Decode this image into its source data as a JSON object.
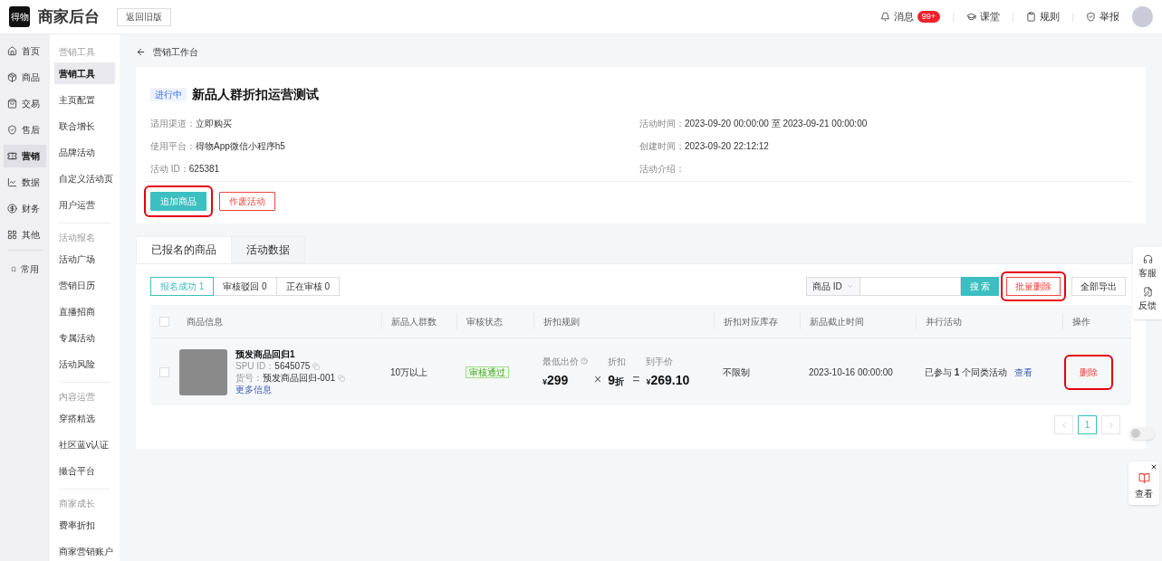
{
  "header": {
    "logo": "得物",
    "title": "商家后台",
    "old_version_button": "返回旧版",
    "links": [
      {
        "kind": "bell",
        "label": "消息",
        "badge": "99+"
      },
      {
        "kind": "cap",
        "label": "课堂"
      },
      {
        "kind": "clipboard",
        "label": "规则"
      },
      {
        "kind": "shield",
        "label": "举报"
      }
    ]
  },
  "main_nav": {
    "groups": [
      [
        {
          "kind": "home",
          "label": "首页",
          "selected": false
        },
        {
          "kind": "box",
          "label": "商品",
          "selected": false
        },
        {
          "kind": "bag",
          "label": "交易",
          "selected": false
        },
        {
          "kind": "shield",
          "label": "售后",
          "selected": false
        },
        {
          "kind": "ticket",
          "label": "营销",
          "selected": true
        },
        {
          "kind": "chart",
          "label": "数据",
          "selected": false
        },
        {
          "kind": "coin",
          "label": "财务",
          "selected": false
        },
        {
          "kind": "grid",
          "label": "其他",
          "selected": false
        }
      ],
      [
        {
          "kind": "bookmark",
          "label": "常用",
          "selected": false
        }
      ]
    ]
  },
  "sub_nav": [
    {
      "heading": "营销工具",
      "items": [
        {
          "label": "营销工具",
          "selected": true
        },
        {
          "label": "主页配置",
          "selected": false
        },
        {
          "label": "联合增长",
          "selected": false
        },
        {
          "label": "品牌活动",
          "selected": false
        },
        {
          "label": "自定义活动页",
          "selected": false
        },
        {
          "label": "用户运营",
          "selected": false
        }
      ]
    },
    {
      "heading": "活动报名",
      "items": [
        {
          "label": "活动广场",
          "selected": false
        },
        {
          "label": "营销日历",
          "selected": false
        },
        {
          "label": "直播招商",
          "selected": false
        },
        {
          "label": "专属活动",
          "selected": false
        },
        {
          "label": "活动风险",
          "selected": false
        }
      ]
    },
    {
      "heading": "内容运营",
      "items": [
        {
          "label": "穿搭精选",
          "selected": false
        },
        {
          "label": "社区蓝v认证",
          "selected": false
        },
        {
          "label": "撮合平台",
          "selected": false
        }
      ]
    },
    {
      "heading": "商家成长",
      "items": [
        {
          "label": "费率折扣",
          "selected": false
        },
        {
          "label": "商家营销账户",
          "selected": false
        }
      ]
    }
  ],
  "breadcrumb": "营销工作台",
  "activity": {
    "status": "进行中",
    "title": "新品人群折扣运营测试",
    "fields_left": [
      {
        "label": "适用渠道：",
        "value": "立即购买"
      },
      {
        "label": "使用平台：",
        "value": "得物App微信小程序h5"
      },
      {
        "label": "活动 ID：",
        "value": "625381"
      }
    ],
    "fields_right": [
      {
        "label": "活动时间：",
        "value": "2023-09-20 00:00:00 至 2023-09-21 00:00:00"
      },
      {
        "label": "创建时间：",
        "value": "2023-09-20 22:12:12"
      },
      {
        "label": "活动介绍："
      }
    ],
    "buttons": [
      {
        "kind": "primary",
        "label": "追加商品",
        "highlighted": true
      },
      {
        "kind": "danger",
        "label": "作废活动",
        "highlighted": false
      }
    ]
  },
  "tabs": [
    {
      "label": "已报名的商品",
      "selected": true
    },
    {
      "label": "活动数据",
      "selected": false
    }
  ],
  "filters": [
    {
      "label": "报名成功 1",
      "selected": true
    },
    {
      "label": "审核驳回 0",
      "selected": false
    },
    {
      "label": "正在审核 0",
      "selected": false
    }
  ],
  "search": {
    "field_type": "商品 ID",
    "button": "搜 索"
  },
  "actions": [
    {
      "kind": "danger",
      "label": "批量删除",
      "highlighted": true
    },
    {
      "kind": "default",
      "label": "全部导出",
      "highlighted": false
    }
  ],
  "table": {
    "select_all": {
      "checked": false
    },
    "columns": [
      "商品信息",
      "新品人群数",
      "审核状态",
      "折扣规则",
      "折扣对应库存",
      "新品截止时间",
      "并行活动",
      "操作"
    ],
    "rows": [
      {
        "checked": false,
        "product": {
          "name": "预发商品回归1",
          "spu_label": "SPU ID：",
          "spu": "5645075",
          "sku_label": "货号：",
          "sku": "预发商品回归-001",
          "more": "更多信息"
        },
        "audience": "10万以上",
        "status": "审核通过",
        "rule": {
          "min_label": "最低出价",
          "min_currency": "¥",
          "min_price": "299",
          "times": "×",
          "discount_label": "折扣",
          "discount": "9",
          "discount_unit": "折",
          "equals": "=",
          "final_label": "到手价",
          "final_currency": "¥",
          "final_price": "269.10"
        },
        "stock": "不限制",
        "deadline": "2023-10-16 00:00:00",
        "parallel": "已参与 **1** 个同类活动",
        "parallel_link": "查看",
        "action": {
          "label": "删除",
          "highlighted": true
        }
      }
    ]
  },
  "pagination": {
    "pages": [
      {
        "label": "1",
        "selected": true
      }
    ]
  },
  "toggle": {
    "on": false
  },
  "float_tools": [
    {
      "kind": "headset",
      "label": "客服"
    },
    {
      "kind": "edit",
      "label": "反馈"
    }
  ],
  "float_card": {
    "label": "查看"
  }
}
